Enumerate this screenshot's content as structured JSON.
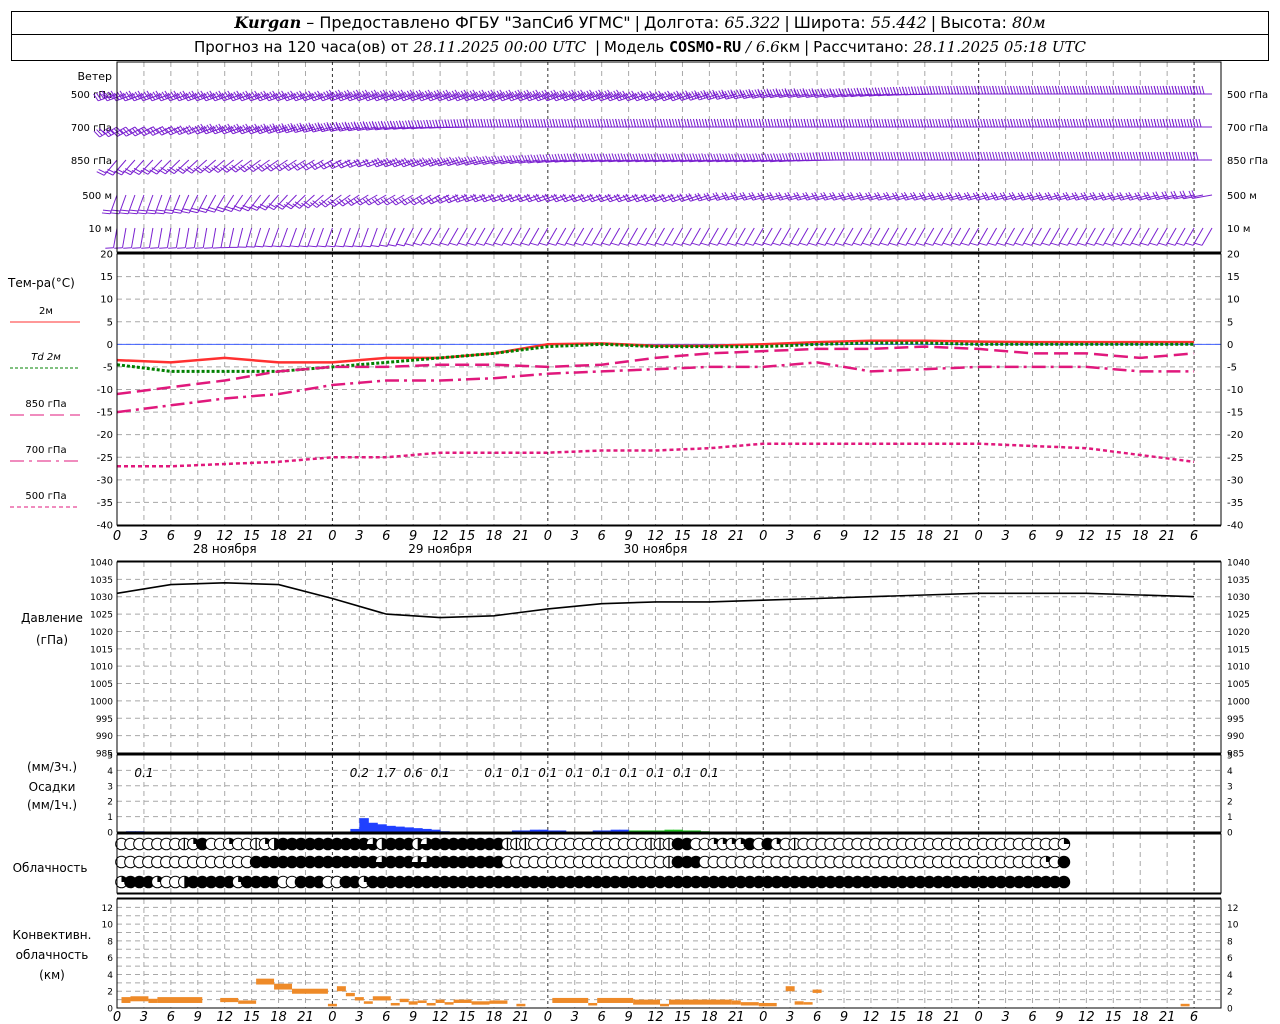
{
  "header": {
    "station": "Kurgan",
    "dash": "–",
    "provider": "Предоставлено ФГБУ \"ЗапСиб УГМС\"",
    "lon_label": "Долгота:",
    "lon_value": "65.322",
    "lat_label": "Широта:",
    "lat_value": "55.442",
    "alt_label": "Высота:",
    "alt_value": "80м",
    "sep": "|",
    "forecast_label": "Прогноз на 120 часа(ов) от",
    "forecast_start": "28.11.2025 00:00 UTC",
    "model_label": "Модель",
    "model_name": "COSMO-RU",
    "model_sep": "/",
    "model_res_value": "6.6",
    "model_res_unit": "км",
    "computed_label": "Рассчитано:",
    "computed_time": "28.11.2025 05:18 UTC"
  },
  "colors": {
    "wind": "#7a20d0",
    "t2m": "#ff3030",
    "td2m": "#008000",
    "t850": "#e0187c",
    "t700": "#e0187c",
    "t500": "#e0187c",
    "zero_line": "#4060ff",
    "pressure": "#000000",
    "precip_blue": "#2040ff",
    "precip_green": "#20c020",
    "convective": "#ee8a28",
    "grid": "#a8a8a8"
  },
  "time_axis": {
    "hour_labels": [
      "0",
      "3",
      "6",
      "9",
      "12",
      "15",
      "18",
      "21"
    ],
    "final_labels": [
      "0",
      "3",
      "6"
    ],
    "day_labels": [
      "28 ноября",
      "29 ноября",
      "30 ноября"
    ]
  },
  "wind_panel": {
    "title": "Ветер",
    "levels": [
      "500 гПа",
      "700 гПа",
      "850 гПа",
      "500 м",
      "10 м"
    ]
  },
  "chart_data": [
    {
      "type": "line",
      "title": "Тем-ра(°C)",
      "x_unit": "hours from 28.11.2025 00:00 UTC",
      "ylim": [
        -40,
        20
      ],
      "yticks": [
        "20",
        "15",
        "10",
        "5",
        "0",
        "-5",
        "-10",
        "-15",
        "-20",
        "-25",
        "-30",
        "-35",
        "-40"
      ],
      "grid": true,
      "series": [
        {
          "name": "2м",
          "style": "solid",
          "x": [
            0,
            6,
            12,
            18,
            24,
            30,
            36,
            42,
            48,
            54,
            60,
            66,
            72,
            78,
            84,
            90,
            96,
            102,
            108,
            114,
            120
          ],
          "y": [
            -3.5,
            -4,
            -3,
            -4,
            -4,
            -3,
            -3,
            -2,
            0,
            0.2,
            -0.3,
            -0.3,
            0,
            0.5,
            0.8,
            0.8,
            0.6,
            0.5,
            0.5,
            0.5,
            0.5
          ]
        },
        {
          "name": "Td 2м",
          "style": "dotted",
          "x": [
            0,
            6,
            12,
            18,
            24,
            30,
            36,
            42,
            48,
            54,
            60,
            66,
            72,
            78,
            84,
            90,
            96,
            102,
            108,
            114,
            120
          ],
          "y": [
            -4.5,
            -6,
            -6,
            -6,
            -5,
            -4,
            -3,
            -2,
            -0.5,
            0,
            -0.5,
            -0.5,
            -0.5,
            0,
            0.3,
            0.3,
            0,
            0,
            0,
            0,
            0
          ]
        },
        {
          "name": "850 гПа",
          "style": "dashed",
          "x": [
            0,
            6,
            12,
            18,
            24,
            30,
            36,
            42,
            48,
            54,
            60,
            66,
            72,
            78,
            84,
            90,
            96,
            102,
            108,
            114,
            120
          ],
          "y": [
            -11,
            -9.5,
            -8,
            -6,
            -5,
            -5,
            -4.5,
            -4.5,
            -5,
            -4.5,
            -3,
            -2,
            -1.5,
            -1,
            -1,
            -0.5,
            -1,
            -2,
            -2,
            -3,
            -2
          ]
        },
        {
          "name": "700 гПа",
          "style": "dashdot",
          "x": [
            0,
            6,
            12,
            18,
            24,
            30,
            36,
            42,
            48,
            54,
            60,
            66,
            72,
            78,
            84,
            90,
            96,
            102,
            108,
            114,
            120
          ],
          "y": [
            -15,
            -13.5,
            -12,
            -11,
            -9,
            -8,
            -8,
            -7.5,
            -6.5,
            -6,
            -5.5,
            -5,
            -5,
            -4,
            -6,
            -5.5,
            -5,
            -5,
            -5,
            -6,
            -6
          ]
        },
        {
          "name": "500 гПа",
          "style": "short-dash",
          "x": [
            0,
            6,
            12,
            18,
            24,
            30,
            36,
            42,
            48,
            54,
            60,
            66,
            72,
            78,
            84,
            90,
            96,
            102,
            108,
            114,
            120
          ],
          "y": [
            -27,
            -27,
            -26.5,
            -26,
            -25,
            -25,
            -24,
            -24,
            -24,
            -23.5,
            -23.5,
            -23,
            -22,
            -22,
            -22,
            -22,
            -22,
            -22.5,
            -23,
            -24.5,
            -26
          ]
        }
      ]
    },
    {
      "type": "line",
      "title": "Давление",
      "ylabel": "(гПа)",
      "x_unit": "hours from 28.11.2025 00:00 UTC",
      "ylim": [
        985,
        1040
      ],
      "yticks": [
        "1040",
        "1035",
        "1030",
        "1025",
        "1020",
        "1015",
        "1010",
        "1005",
        "1000",
        "995",
        "990",
        "985"
      ],
      "grid": true,
      "series": [
        {
          "x": [
            0,
            6,
            12,
            18,
            24,
            30,
            36,
            42,
            48,
            54,
            60,
            66,
            72,
            78,
            84,
            90,
            96,
            102,
            108,
            114,
            120
          ],
          "y": [
            1031,
            1033.5,
            1034,
            1033.5,
            1029.5,
            1025,
            1024,
            1024.5,
            1026.5,
            1028,
            1028.5,
            1028.5,
            1029,
            1029.5,
            1030,
            1030.5,
            1031,
            1031,
            1031,
            1030.5,
            1030
          ]
        }
      ]
    },
    {
      "type": "bar",
      "title": "Осадки",
      "ylabel_top": "(мм/3ч.)",
      "ylabel_bottom": "(мм/1ч.)",
      "x_unit": "hours from 28.11.2025 00:00 UTC",
      "ylim": [
        0,
        5
      ],
      "yticks": [
        "5",
        "4",
        "3",
        "2",
        "1",
        "0"
      ],
      "grid": true,
      "totals_3h": [
        {
          "x": 3,
          "label": "0.1"
        },
        {
          "x": 27,
          "label": "0.2"
        },
        {
          "x": 30,
          "label": "1.7"
        },
        {
          "x": 33,
          "label": "0.6"
        },
        {
          "x": 36,
          "label": "0.1"
        },
        {
          "x": 42,
          "label": "0.1"
        },
        {
          "x": 45,
          "label": "0.1"
        },
        {
          "x": 48,
          "label": "0.1"
        },
        {
          "x": 51,
          "label": "0.1"
        },
        {
          "x": 54,
          "label": "0.1"
        },
        {
          "x": 57,
          "label": "0.1"
        },
        {
          "x": 60,
          "label": "0.1"
        },
        {
          "x": 63,
          "label": "0.1"
        },
        {
          "x": 66,
          "label": "0.1"
        }
      ],
      "x": [
        2,
        3,
        27,
        28,
        29,
        30,
        31,
        32,
        33,
        34,
        35,
        36,
        37,
        45,
        46,
        47,
        48,
        49,
        50,
        54,
        55,
        56,
        57,
        58,
        59,
        60,
        61,
        62,
        63,
        64,
        65,
        66
      ],
      "values": [
        0.05,
        0.05,
        0.2,
        0.9,
        0.6,
        0.5,
        0.4,
        0.35,
        0.3,
        0.25,
        0.2,
        0.15,
        0.05,
        0.1,
        0.1,
        0.15,
        0.15,
        0.1,
        0.1,
        0.1,
        0.1,
        0.15,
        0.15,
        0.1,
        0.1,
        0.1,
        0.1,
        0.15,
        0.15,
        0.1,
        0.1,
        0.05
      ],
      "phase": [
        "blue",
        "blue",
        "blue",
        "blue",
        "blue",
        "blue",
        "blue",
        "blue",
        "blue",
        "blue",
        "blue",
        "blue",
        "blue",
        "blue",
        "blue",
        "blue",
        "blue",
        "blue",
        "blue",
        "blue",
        "blue",
        "blue",
        "blue",
        "green",
        "green",
        "green",
        "green",
        "green",
        "green",
        "green",
        "green",
        "green"
      ]
    },
    {
      "type": "bar",
      "title": "Конвективн. облачность",
      "ylabel": "(км)",
      "x_unit": "hours from 28.11.2025 00:00 UTC",
      "ylim": [
        0,
        13
      ],
      "yticks": [
        "12",
        "10",
        "8",
        "6",
        "4",
        "2",
        "0"
      ],
      "grid": true,
      "segments": [
        {
          "x0": 0.5,
          "x1": 1.5,
          "y0": 0.6,
          "y1": 1.3
        },
        {
          "x0": 1.5,
          "x1": 3.5,
          "y0": 0.8,
          "y1": 1.4
        },
        {
          "x0": 3.5,
          "x1": 4.5,
          "y0": 0.6,
          "y1": 1.1
        },
        {
          "x0": 4.5,
          "x1": 9.5,
          "y0": 0.6,
          "y1": 1.3
        },
        {
          "x0": 11.5,
          "x1": 13.5,
          "y0": 0.7,
          "y1": 1.2
        },
        {
          "x0": 13.5,
          "x1": 15.5,
          "y0": 0.5,
          "y1": 0.9
        },
        {
          "x0": 15.5,
          "x1": 17.5,
          "y0": 2.8,
          "y1": 3.5
        },
        {
          "x0": 17.5,
          "x1": 19.5,
          "y0": 2.2,
          "y1": 2.9
        },
        {
          "x0": 19.5,
          "x1": 23.5,
          "y0": 1.7,
          "y1": 2.3
        },
        {
          "x0": 23.5,
          "x1": 24.5,
          "y0": 0.2,
          "y1": 0.5
        },
        {
          "x0": 24.5,
          "x1": 25.5,
          "y0": 2.0,
          "y1": 2.6
        },
        {
          "x0": 25.5,
          "x1": 26.5,
          "y0": 1.4,
          "y1": 1.8
        },
        {
          "x0": 26.5,
          "x1": 27.5,
          "y0": 0.9,
          "y1": 1.3
        },
        {
          "x0": 27.5,
          "x1": 28.5,
          "y0": 0.5,
          "y1": 0.8
        },
        {
          "x0": 28.5,
          "x1": 30.5,
          "y0": 0.9,
          "y1": 1.4
        },
        {
          "x0": 30.5,
          "x1": 31.5,
          "y0": 0.3,
          "y1": 0.6
        },
        {
          "x0": 31.5,
          "x1": 32.5,
          "y0": 0.7,
          "y1": 1.1
        },
        {
          "x0": 32.5,
          "x1": 33.5,
          "y0": 0.4,
          "y1": 0.8
        },
        {
          "x0": 33.5,
          "x1": 34.5,
          "y0": 0.6,
          "y1": 0.9
        },
        {
          "x0": 34.5,
          "x1": 35.5,
          "y0": 0.3,
          "y1": 0.6
        },
        {
          "x0": 35.5,
          "x1": 36.5,
          "y0": 0.6,
          "y1": 1.0
        },
        {
          "x0": 36.5,
          "x1": 37.5,
          "y0": 0.4,
          "y1": 0.7
        },
        {
          "x0": 37.5,
          "x1": 39.5,
          "y0": 0.6,
          "y1": 1.0
        },
        {
          "x0": 39.5,
          "x1": 41.5,
          "y0": 0.4,
          "y1": 0.8
        },
        {
          "x0": 41.5,
          "x1": 43.5,
          "y0": 0.5,
          "y1": 0.9
        },
        {
          "x0": 44.5,
          "x1": 45.5,
          "y0": 0.2,
          "y1": 0.5
        },
        {
          "x0": 48.5,
          "x1": 52.5,
          "y0": 0.6,
          "y1": 1.2
        },
        {
          "x0": 52.5,
          "x1": 53.5,
          "y0": 0.3,
          "y1": 0.6
        },
        {
          "x0": 53.5,
          "x1": 57.5,
          "y0": 0.6,
          "y1": 1.2
        },
        {
          "x0": 57.5,
          "x1": 60.5,
          "y0": 0.4,
          "y1": 1.0
        },
        {
          "x0": 60.5,
          "x1": 61.5,
          "y0": 0.2,
          "y1": 0.5
        },
        {
          "x0": 61.5,
          "x1": 68.5,
          "y0": 0.4,
          "y1": 1.0
        },
        {
          "x0": 68.5,
          "x1": 69.5,
          "y0": 0.4,
          "y1": 0.9
        },
        {
          "x0": 69.5,
          "x1": 71.5,
          "y0": 0.3,
          "y1": 0.7
        },
        {
          "x0": 71.5,
          "x1": 73.5,
          "y0": 0.2,
          "y1": 0.6
        },
        {
          "x0": 74.5,
          "x1": 75.5,
          "y0": 2.0,
          "y1": 2.6
        },
        {
          "x0": 75.5,
          "x1": 76.5,
          "y0": 0.4,
          "y1": 0.8
        },
        {
          "x0": 76.5,
          "x1": 77.5,
          "y0": 0.4,
          "y1": 0.7
        },
        {
          "x0": 77.5,
          "x1": 78.5,
          "y0": 1.8,
          "y1": 2.2
        },
        {
          "x0": 118.5,
          "x1": 119.5,
          "y0": 0.2,
          "y1": 0.5
        }
      ]
    }
  ],
  "clouds": {
    "title": "Облачность",
    "rows": [
      "0000000124002001234444444444834443844444444111000000000000011144002222404201000000000000000000000000000002",
      "0000000000000004444444444444484448844444444000000000000000000144400000000000000000000000000000000000000204",
      "2444200344444244440044400442444444444444444444444444444444444444444444444444444444444444444444444444444444"
    ]
  },
  "wind_barbs": {
    "rows": [
      {
        "dir": [
          250,
          250,
          250,
          250,
          250,
          250,
          250,
          250,
          250,
          250,
          250,
          250,
          255,
          260,
          260,
          265,
          270,
          270,
          270,
          270,
          270,
          270
        ],
        "spd": [
          20,
          22,
          22,
          22,
          22,
          25,
          25,
          25,
          25,
          25,
          22,
          22,
          22,
          22,
          22,
          20,
          22,
          22,
          22,
          22,
          22,
          25
        ]
      },
      {
        "dir": [
          240,
          245,
          250,
          250,
          255,
          260,
          265,
          270,
          270,
          270,
          270,
          270,
          270,
          270,
          270,
          270,
          270,
          270,
          270,
          270,
          270,
          270
        ],
        "spd": [
          15,
          15,
          18,
          18,
          20,
          20,
          20,
          20,
          20,
          20,
          18,
          18,
          18,
          18,
          20,
          20,
          20,
          20,
          20,
          20,
          20,
          20
        ]
      },
      {
        "dir": [
          220,
          225,
          230,
          235,
          240,
          250,
          250,
          255,
          260,
          265,
          265,
          265,
          265,
          265,
          270,
          270,
          270,
          270,
          270,
          270,
          270,
          270
        ],
        "spd": [
          12,
          12,
          12,
          12,
          12,
          12,
          15,
          15,
          15,
          15,
          15,
          15,
          15,
          15,
          15,
          15,
          15,
          15,
          15,
          15,
          15,
          15
        ]
      },
      {
        "dir": [
          200,
          200,
          210,
          220,
          230,
          240,
          240,
          250,
          250,
          250,
          250,
          250,
          255,
          255,
          255,
          255,
          255,
          255,
          255,
          255,
          255,
          260
        ],
        "spd": [
          8,
          8,
          8,
          10,
          10,
          10,
          10,
          10,
          10,
          10,
          10,
          10,
          10,
          10,
          10,
          10,
          10,
          10,
          10,
          10,
          10,
          10
        ]
      },
      {
        "dir": [
          190,
          190,
          190,
          200,
          200,
          200,
          210,
          210,
          210,
          210,
          210,
          210,
          210,
          210,
          210,
          210,
          210,
          210,
          210,
          210,
          210,
          210
        ],
        "spd": [
          4,
          4,
          5,
          5,
          5,
          5,
          5,
          5,
          5,
          5,
          5,
          5,
          5,
          5,
          5,
          5,
          5,
          5,
          5,
          5,
          5,
          5
        ]
      }
    ]
  }
}
